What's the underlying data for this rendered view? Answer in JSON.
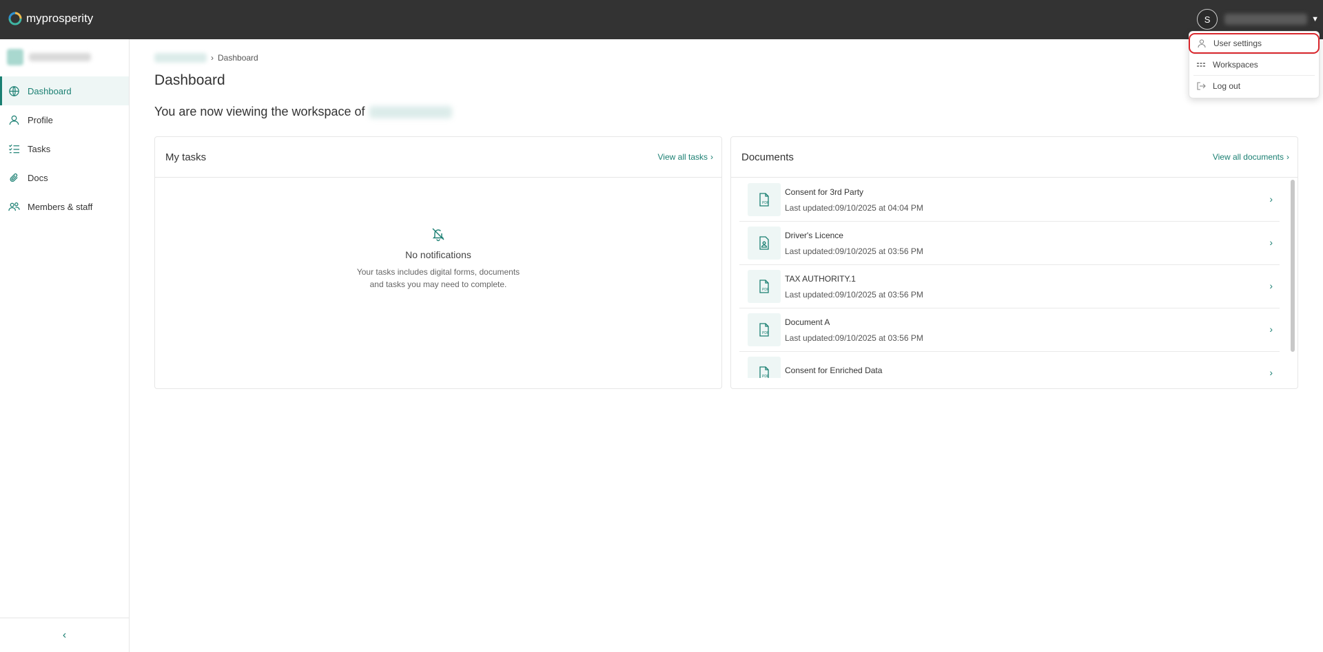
{
  "app": {
    "brand": "myprosperity"
  },
  "header": {
    "avatar_initial": "S"
  },
  "user_menu": {
    "items": [
      {
        "label": "User settings",
        "icon": "user-icon"
      },
      {
        "label": "Workspaces",
        "icon": "grid-icon"
      },
      {
        "label": "Log out",
        "icon": "logout-icon"
      }
    ]
  },
  "sidebar": {
    "items": [
      {
        "label": "Dashboard",
        "icon": "globe-icon"
      },
      {
        "label": "Profile",
        "icon": "person-icon"
      },
      {
        "label": "Tasks",
        "icon": "checklist-icon"
      },
      {
        "label": "Docs",
        "icon": "paperclip-icon"
      },
      {
        "label": "Members & staff",
        "icon": "people-icon"
      }
    ],
    "collapse_glyph": "‹"
  },
  "breadcrumb": {
    "current": "Dashboard"
  },
  "page": {
    "title": "Dashboard",
    "workspace_text": "You are now viewing the workspace of"
  },
  "tasks_card": {
    "title": "My tasks",
    "link": "View all tasks",
    "empty_title": "No notifications",
    "empty_line1": "Your tasks includes digital forms, documents",
    "empty_line2": "and tasks you may need to complete."
  },
  "documents_card": {
    "title": "Documents",
    "link": "View all documents",
    "items": [
      {
        "name": "Consent for 3rd Party",
        "updated": "Last updated:09/10/2025 at 04:04 PM",
        "icon": "pdf-file-icon"
      },
      {
        "name": "Driver's Licence",
        "updated": "Last updated:09/10/2025 at 03:56 PM",
        "icon": "image-file-icon"
      },
      {
        "name": "TAX AUTHORITY.1",
        "updated": "Last updated:09/10/2025 at 03:56 PM",
        "icon": "pdf-file-icon"
      },
      {
        "name": "Document A",
        "updated": "Last updated:09/10/2025 at 03:56 PM",
        "icon": "pdf-file-icon"
      },
      {
        "name": "Consent for Enriched Data",
        "updated": "",
        "icon": "pdf-file-icon"
      }
    ]
  },
  "colors": {
    "topbar": "#333333",
    "accent": "#1a7f72",
    "highlight": "#d9262c"
  }
}
